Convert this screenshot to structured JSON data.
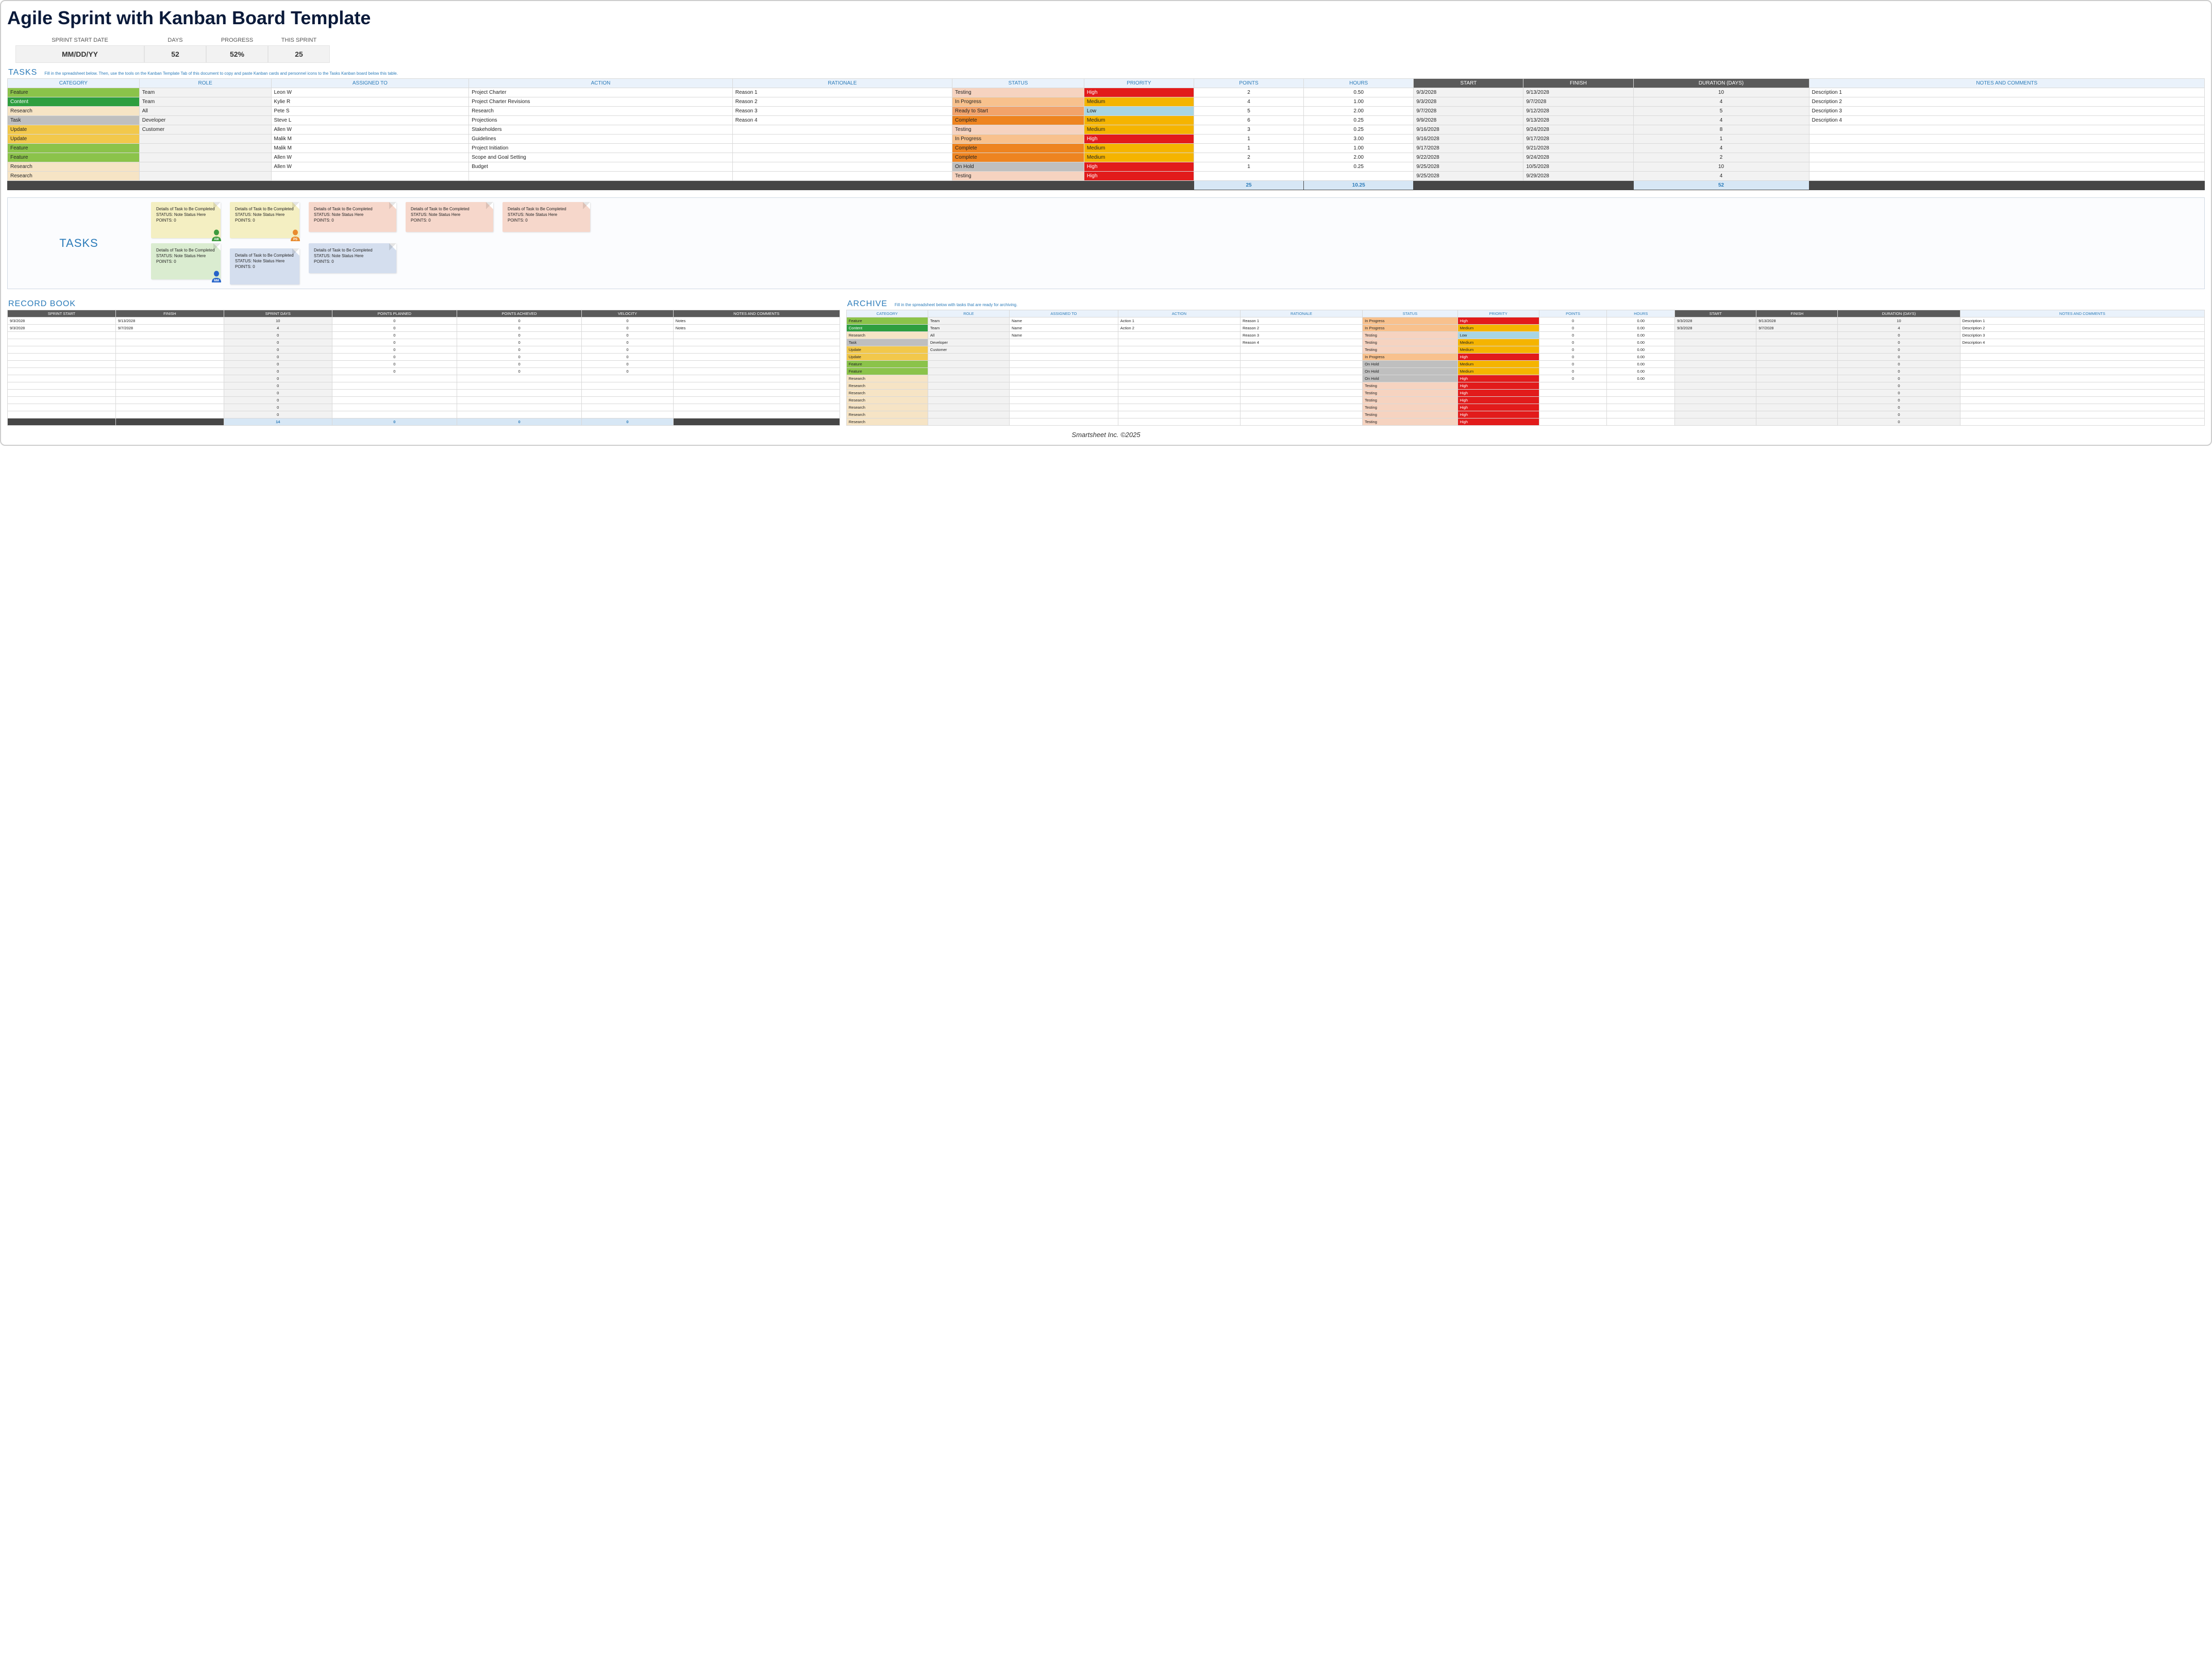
{
  "title": "Agile Sprint with Kanban Board Template",
  "summary": {
    "labels": {
      "start": "SPRINT START DATE",
      "days": "DAYS",
      "progress": "PROGRESS",
      "sprint": "THIS SPRINT"
    },
    "values": {
      "start": "MM/DD/YY",
      "days": "52",
      "progress": "52%",
      "sprint": "25"
    }
  },
  "tasksSection": {
    "title": "TASKS",
    "hint": "Fill in the spreadsheet below. Then, use the tools on the Kanban Template Tab of this document to copy and paste Kanban cards and personnel icons to the Tasks Kanban board below this table."
  },
  "headers": {
    "category": "CATEGORY",
    "role": "ROLE",
    "assigned": "ASSIGNED TO",
    "action": "ACTION",
    "rationale": "RATIONALE",
    "status": "STATUS",
    "priority": "PRIORITY",
    "points": "POINTS",
    "hours": "HOURS",
    "start": "START",
    "finish": "FINISH",
    "duration": "DURATION (DAYS)",
    "notes": "NOTES AND COMMENTS"
  },
  "tasks": [
    {
      "cat": "Feature",
      "catCls": "cat-feature",
      "role": "Team",
      "assigned": "Leon W",
      "action": "Project Charter",
      "rationale": "Reason 1",
      "status": "Testing",
      "stCls": "st-testing",
      "priority": "High",
      "prCls": "pr-high",
      "points": "2",
      "hours": "0.50",
      "start": "9/3/2028",
      "finish": "9/13/2028",
      "dur": "10",
      "notes": "Description 1"
    },
    {
      "cat": "Content",
      "catCls": "cat-content",
      "role": "Team",
      "assigned": "Kylie R",
      "action": "Project Charter Revisions",
      "rationale": "Reason 2",
      "status": "In Progress",
      "stCls": "st-inprogress",
      "priority": "Medium",
      "prCls": "pr-medium",
      "points": "4",
      "hours": "1.00",
      "start": "9/3/2028",
      "finish": "9/7/2028",
      "dur": "4",
      "notes": "Description 2"
    },
    {
      "cat": "Research",
      "catCls": "cat-research",
      "role": "All",
      "assigned": "Pete S",
      "action": "Research",
      "rationale": "Reason 3",
      "status": "Ready to Start",
      "stCls": "st-ready",
      "priority": "Low",
      "prCls": "pr-low",
      "points": "5",
      "hours": "2.00",
      "start": "9/7/2028",
      "finish": "9/12/2028",
      "dur": "5",
      "notes": "Description 3"
    },
    {
      "cat": "Task",
      "catCls": "cat-task",
      "role": "Developer",
      "assigned": "Steve L",
      "action": "Projections",
      "rationale": "Reason 4",
      "status": "Complete",
      "stCls": "st-complete",
      "priority": "Medium",
      "prCls": "pr-medium",
      "points": "6",
      "hours": "0.25",
      "start": "9/9/2028",
      "finish": "9/13/2028",
      "dur": "4",
      "notes": "Description 4"
    },
    {
      "cat": "Update",
      "catCls": "cat-update",
      "role": "Customer",
      "assigned": "Allen W",
      "action": "Stakeholders",
      "rationale": "",
      "status": "Testing",
      "stCls": "st-testing",
      "priority": "Medium",
      "prCls": "pr-medium",
      "points": "3",
      "hours": "0.25",
      "start": "9/16/2028",
      "finish": "9/24/2028",
      "dur": "8",
      "notes": ""
    },
    {
      "cat": "Update",
      "catCls": "cat-update",
      "role": "",
      "assigned": "Malik M",
      "action": "Guidelines",
      "rationale": "",
      "status": "In Progress",
      "stCls": "st-inprogress",
      "priority": "High",
      "prCls": "pr-high",
      "points": "1",
      "hours": "3.00",
      "start": "9/16/2028",
      "finish": "9/17/2028",
      "dur": "1",
      "notes": ""
    },
    {
      "cat": "Feature",
      "catCls": "cat-feature",
      "role": "",
      "assigned": "Malik M",
      "action": "Project Initiation",
      "rationale": "",
      "status": "Complete",
      "stCls": "st-complete",
      "priority": "Medium",
      "prCls": "pr-medium",
      "points": "1",
      "hours": "1.00",
      "start": "9/17/2028",
      "finish": "9/21/2028",
      "dur": "4",
      "notes": ""
    },
    {
      "cat": "Feature",
      "catCls": "cat-feature",
      "role": "",
      "assigned": "Allen W",
      "action": "Scope and Goal Setting",
      "rationale": "",
      "status": "Complete",
      "stCls": "st-complete",
      "priority": "Medium",
      "prCls": "pr-medium",
      "points": "2",
      "hours": "2.00",
      "start": "9/22/2028",
      "finish": "9/24/2028",
      "dur": "2",
      "notes": ""
    },
    {
      "cat": "Research",
      "catCls": "cat-research",
      "role": "",
      "assigned": "Allen W",
      "action": "Budget",
      "rationale": "",
      "status": "On Hold",
      "stCls": "st-onhold",
      "priority": "High",
      "prCls": "pr-high",
      "points": "1",
      "hours": "0.25",
      "start": "9/25/2028",
      "finish": "10/5/2028",
      "dur": "10",
      "notes": ""
    },
    {
      "cat": "Research",
      "catCls": "cat-research",
      "role": "",
      "assigned": "",
      "action": "",
      "rationale": "",
      "status": "Testing",
      "stCls": "st-testing",
      "priority": "High",
      "prCls": "pr-high",
      "points": "",
      "hours": "",
      "start": "9/25/2028",
      "finish": "9/29/2028",
      "dur": "4",
      "notes": ""
    }
  ],
  "taskTotals": {
    "points": "25",
    "hours": "10.25",
    "duration": "52"
  },
  "kanbanLabel": "TASKS",
  "cardText": {
    "title": "Details of Task to Be Completed",
    "status": "STATUS: Note Status Here",
    "points": "POINTS: 0"
  },
  "pawns": {
    "aw": "AW",
    "ps": "PS",
    "mm": "MM"
  },
  "recordBook": {
    "title": "RECORD BOOK",
    "headers": {
      "start": "SPRINT START",
      "finish": "FINISH",
      "days": "SPRINT DAYS",
      "planned": "POINTS PLANNED",
      "achieved": "POINTS ACHIEVED",
      "velocity": "VELOCITY",
      "notes": "NOTES AND COMMENTS"
    },
    "rows": [
      {
        "start": "9/3/2028",
        "finish": "9/13/2028",
        "days": "10",
        "planned": "0",
        "achieved": "0",
        "velocity": "0",
        "notes": "Notes"
      },
      {
        "start": "9/3/2028",
        "finish": "9/7/2028",
        "days": "4",
        "planned": "0",
        "achieved": "0",
        "velocity": "0",
        "notes": "Notes"
      },
      {
        "start": "",
        "finish": "",
        "days": "0",
        "planned": "0",
        "achieved": "0",
        "velocity": "0",
        "notes": ""
      },
      {
        "start": "",
        "finish": "",
        "days": "0",
        "planned": "0",
        "achieved": "0",
        "velocity": "0",
        "notes": ""
      },
      {
        "start": "",
        "finish": "",
        "days": "0",
        "planned": "0",
        "achieved": "0",
        "velocity": "0",
        "notes": ""
      },
      {
        "start": "",
        "finish": "",
        "days": "0",
        "planned": "0",
        "achieved": "0",
        "velocity": "0",
        "notes": ""
      },
      {
        "start": "",
        "finish": "",
        "days": "0",
        "planned": "0",
        "achieved": "0",
        "velocity": "0",
        "notes": ""
      },
      {
        "start": "",
        "finish": "",
        "days": "0",
        "planned": "0",
        "achieved": "0",
        "velocity": "0",
        "notes": ""
      },
      {
        "start": "",
        "finish": "",
        "days": "0",
        "planned": "",
        "achieved": "",
        "velocity": "",
        "notes": ""
      },
      {
        "start": "",
        "finish": "",
        "days": "0",
        "planned": "",
        "achieved": "",
        "velocity": "",
        "notes": ""
      },
      {
        "start": "",
        "finish": "",
        "days": "0",
        "planned": "",
        "achieved": "",
        "velocity": "",
        "notes": ""
      },
      {
        "start": "",
        "finish": "",
        "days": "0",
        "planned": "",
        "achieved": "",
        "velocity": "",
        "notes": ""
      },
      {
        "start": "",
        "finish": "",
        "days": "0",
        "planned": "",
        "achieved": "",
        "velocity": "",
        "notes": ""
      },
      {
        "start": "",
        "finish": "",
        "days": "0",
        "planned": "",
        "achieved": "",
        "velocity": "",
        "notes": ""
      }
    ],
    "totals": {
      "days": "14",
      "planned": "0",
      "achieved": "0",
      "velocity": "0"
    }
  },
  "archive": {
    "title": "ARCHIVE",
    "hint": "Fill in the spreadsheet below with tasks that are ready for archiving.",
    "rows": [
      {
        "cat": "Feature",
        "catCls": "cat-feature",
        "role": "Team",
        "assigned": "Name",
        "action": "Action 1",
        "rationale": "Reason 1",
        "status": "In Progress",
        "stCls": "st-inprogress",
        "priority": "High",
        "prCls": "pr-high",
        "points": "0",
        "hours": "0.00",
        "start": "9/3/2028",
        "finish": "9/13/2028",
        "dur": "10",
        "notes": "Description 1"
      },
      {
        "cat": "Content",
        "catCls": "cat-content",
        "role": "Team",
        "assigned": "Name",
        "action": "Action 2",
        "rationale": "Reason 2",
        "status": "In Progress",
        "stCls": "st-inprogress",
        "priority": "Medium",
        "prCls": "pr-medium",
        "points": "0",
        "hours": "0.00",
        "start": "9/3/2028",
        "finish": "9/7/2028",
        "dur": "4",
        "notes": "Description 2"
      },
      {
        "cat": "Research",
        "catCls": "cat-research",
        "role": "All",
        "assigned": "Name",
        "action": "",
        "rationale": "Reason 3",
        "status": "Testing",
        "stCls": "st-testing",
        "priority": "Low",
        "prCls": "pr-low",
        "points": "0",
        "hours": "0.00",
        "start": "",
        "finish": "",
        "dur": "0",
        "notes": "Description 3"
      },
      {
        "cat": "Task",
        "catCls": "cat-task",
        "role": "Developer",
        "assigned": "",
        "action": "",
        "rationale": "Reason 4",
        "status": "Testing",
        "stCls": "st-testing",
        "priority": "Medium",
        "prCls": "pr-medium",
        "points": "0",
        "hours": "0.00",
        "start": "",
        "finish": "",
        "dur": "0",
        "notes": "Description 4"
      },
      {
        "cat": "Update",
        "catCls": "cat-update",
        "role": "Customer",
        "assigned": "",
        "action": "",
        "rationale": "",
        "status": "Testing",
        "stCls": "st-testing",
        "priority": "Medium",
        "prCls": "pr-medium",
        "points": "0",
        "hours": "0.00",
        "start": "",
        "finish": "",
        "dur": "0",
        "notes": ""
      },
      {
        "cat": "Update",
        "catCls": "cat-update",
        "role": "",
        "assigned": "",
        "action": "",
        "rationale": "",
        "status": "In Progress",
        "stCls": "st-inprogress",
        "priority": "High",
        "prCls": "pr-high",
        "points": "0",
        "hours": "0.00",
        "start": "",
        "finish": "",
        "dur": "0",
        "notes": ""
      },
      {
        "cat": "Feature",
        "catCls": "cat-feature",
        "role": "",
        "assigned": "",
        "action": "",
        "rationale": "",
        "status": "On Hold",
        "stCls": "st-onhold",
        "priority": "Medium",
        "prCls": "pr-medium",
        "points": "0",
        "hours": "0.00",
        "start": "",
        "finish": "",
        "dur": "0",
        "notes": ""
      },
      {
        "cat": "Feature",
        "catCls": "cat-feature",
        "role": "",
        "assigned": "",
        "action": "",
        "rationale": "",
        "status": "On Hold",
        "stCls": "st-onhold",
        "priority": "Medium",
        "prCls": "pr-medium",
        "points": "0",
        "hours": "0.00",
        "start": "",
        "finish": "",
        "dur": "0",
        "notes": ""
      },
      {
        "cat": "Research",
        "catCls": "cat-research",
        "role": "",
        "assigned": "",
        "action": "",
        "rationale": "",
        "status": "On Hold",
        "stCls": "st-onhold",
        "priority": "High",
        "prCls": "pr-high",
        "points": "0",
        "hours": "0.00",
        "start": "",
        "finish": "",
        "dur": "0",
        "notes": ""
      },
      {
        "cat": "Research",
        "catCls": "cat-research",
        "role": "",
        "assigned": "",
        "action": "",
        "rationale": "",
        "status": "Testing",
        "stCls": "st-testing",
        "priority": "High",
        "prCls": "pr-high",
        "points": "",
        "hours": "",
        "start": "",
        "finish": "",
        "dur": "0",
        "notes": ""
      },
      {
        "cat": "Research",
        "catCls": "cat-research",
        "role": "",
        "assigned": "",
        "action": "",
        "rationale": "",
        "status": "Testing",
        "stCls": "st-testing",
        "priority": "High",
        "prCls": "pr-high",
        "points": "",
        "hours": "",
        "start": "",
        "finish": "",
        "dur": "0",
        "notes": ""
      },
      {
        "cat": "Research",
        "catCls": "cat-research",
        "role": "",
        "assigned": "",
        "action": "",
        "rationale": "",
        "status": "Testing",
        "stCls": "st-testing",
        "priority": "High",
        "prCls": "pr-high",
        "points": "",
        "hours": "",
        "start": "",
        "finish": "",
        "dur": "0",
        "notes": ""
      },
      {
        "cat": "Research",
        "catCls": "cat-research",
        "role": "",
        "assigned": "",
        "action": "",
        "rationale": "",
        "status": "Testing",
        "stCls": "st-testing",
        "priority": "High",
        "prCls": "pr-high",
        "points": "",
        "hours": "",
        "start": "",
        "finish": "",
        "dur": "0",
        "notes": ""
      },
      {
        "cat": "Research",
        "catCls": "cat-research",
        "role": "",
        "assigned": "",
        "action": "",
        "rationale": "",
        "status": "Testing",
        "stCls": "st-testing",
        "priority": "High",
        "prCls": "pr-high",
        "points": "",
        "hours": "",
        "start": "",
        "finish": "",
        "dur": "0",
        "notes": ""
      },
      {
        "cat": "Research",
        "catCls": "cat-research",
        "role": "",
        "assigned": "",
        "action": "",
        "rationale": "",
        "status": "Testing",
        "stCls": "st-testing",
        "priority": "High",
        "prCls": "pr-high",
        "points": "",
        "hours": "",
        "start": "",
        "finish": "",
        "dur": "0",
        "notes": ""
      }
    ]
  },
  "footer": "Smartsheet Inc. ©2025"
}
